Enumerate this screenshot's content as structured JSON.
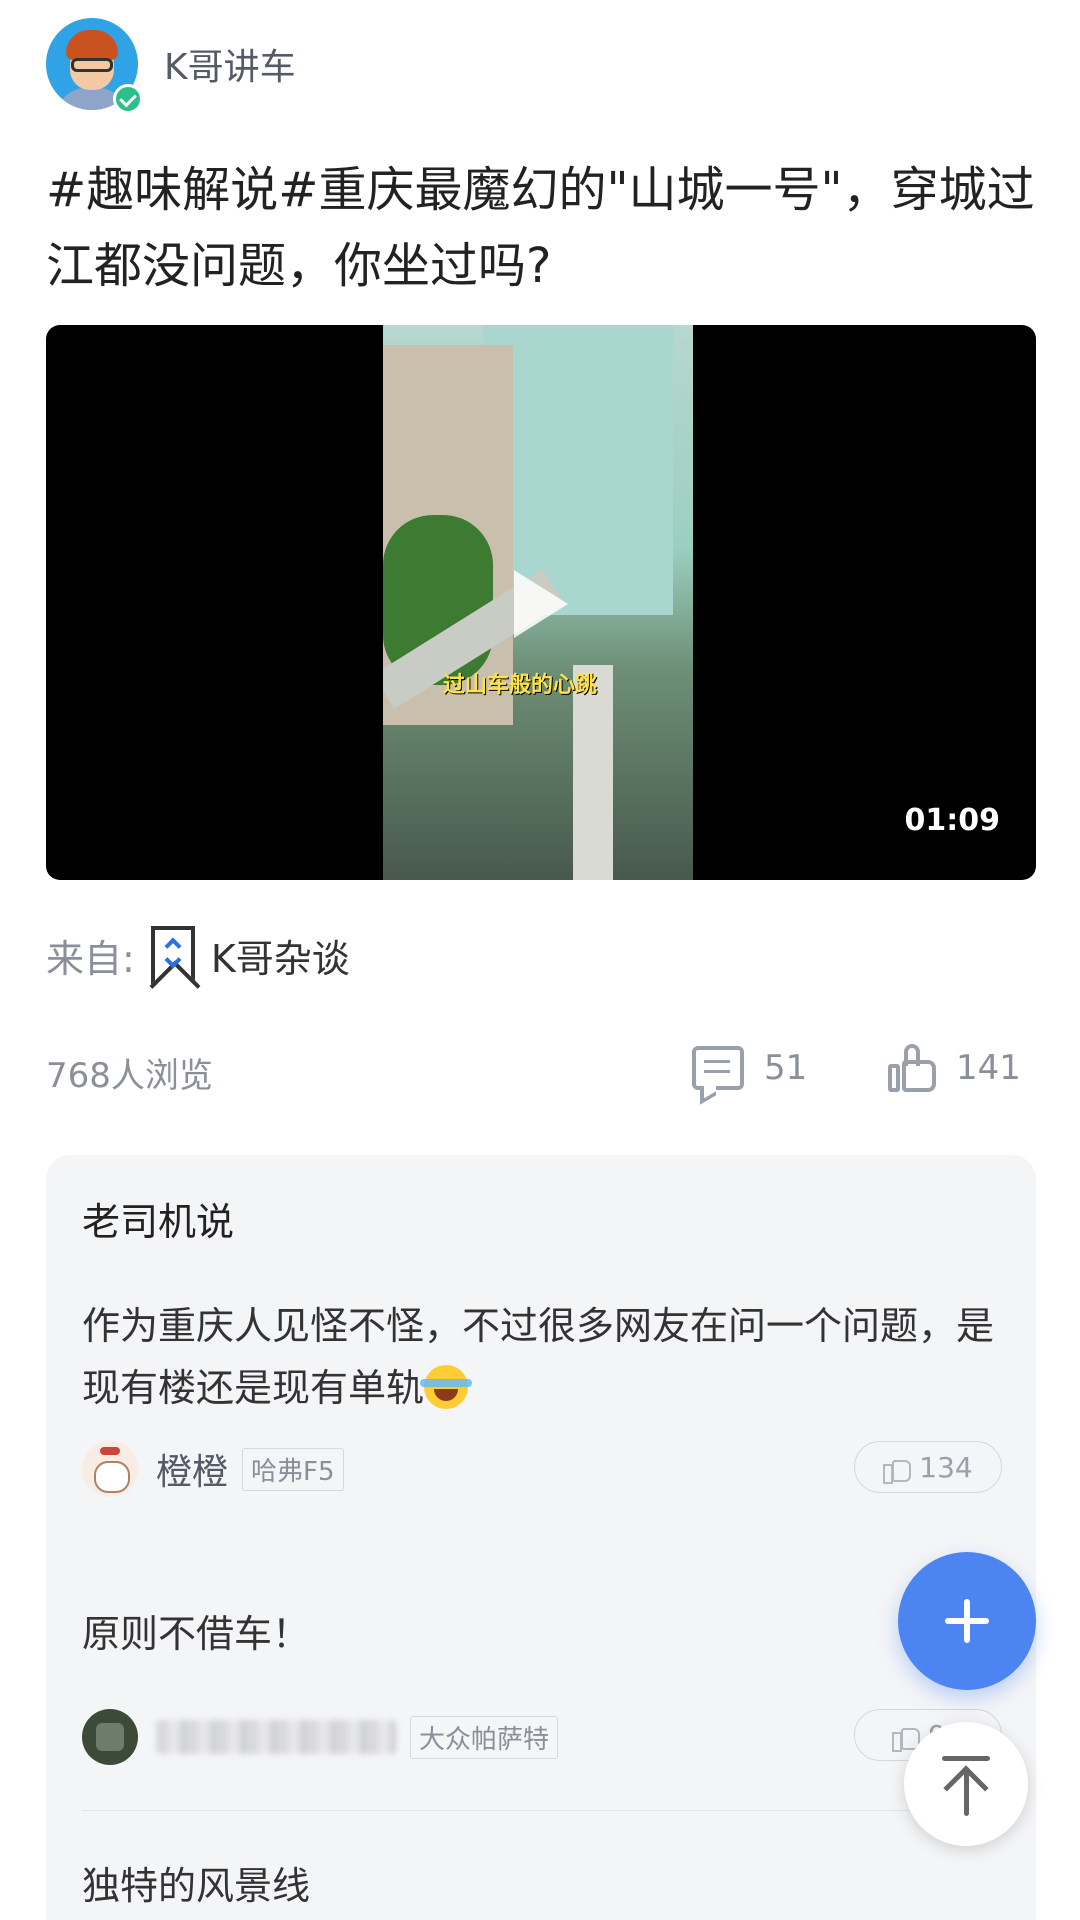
{
  "author": {
    "name": "K哥讲车"
  },
  "post": {
    "title": "#趣味解说#重庆最魔幻的\"山城一号\"，穿城过江都没问题，你坐过吗?"
  },
  "video": {
    "duration": "01:09",
    "overlay_caption": "过山车般的心跳"
  },
  "source": {
    "label": "来自:",
    "name": "K哥杂谈"
  },
  "stats": {
    "views": "768人浏览",
    "comments": "51",
    "likes": "141"
  },
  "comments_section": {
    "heading": "老司机说",
    "items": [
      {
        "text": "作为重庆人见怪不怪，不过很多网友在问一个问题，是现有楼还是现有单轨",
        "user": "橙橙",
        "car_tag": "哈弗F5",
        "likes": "134"
      },
      {
        "text": "原则不借车！",
        "user": "",
        "car_tag": "大众帕萨特",
        "likes": "91"
      },
      {
        "text": "独特的风景线"
      }
    ]
  },
  "colors": {
    "accent": "#4c84f2",
    "muted_text": "#8a8f99",
    "card_bg": "#f4f5f7"
  }
}
